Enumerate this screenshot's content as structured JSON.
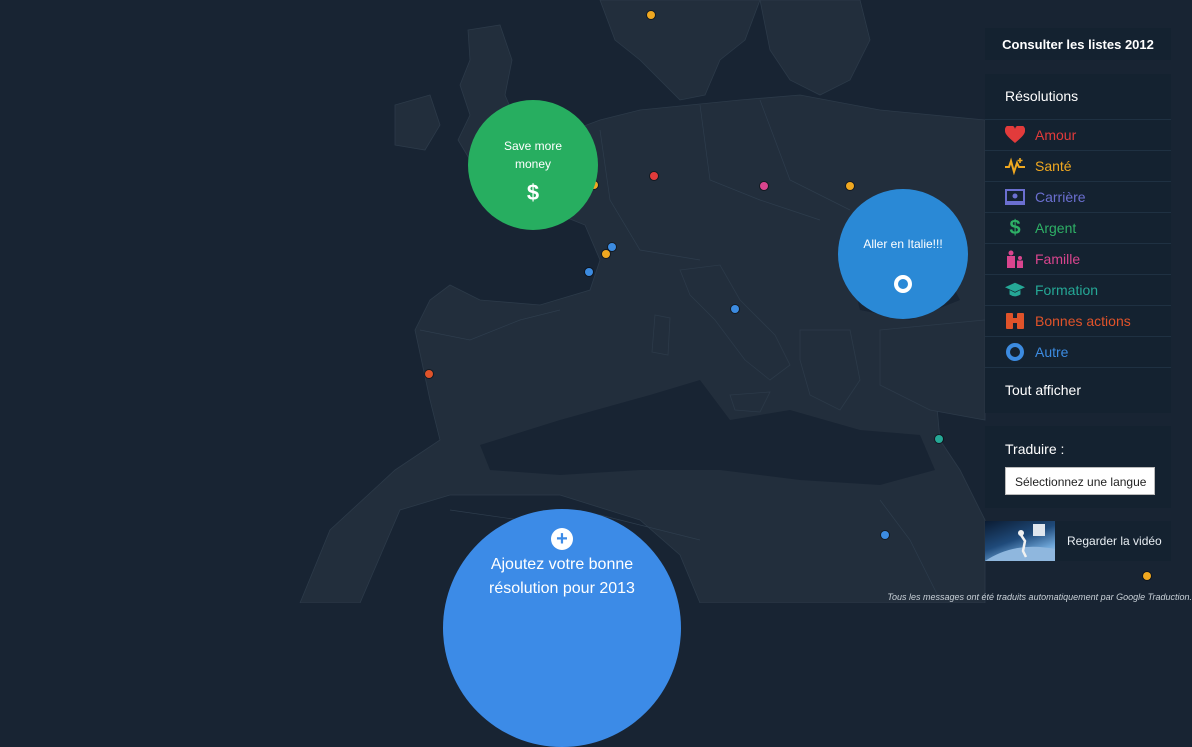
{
  "top_button": {
    "label": "Consulter les listes 2012"
  },
  "resolutions": {
    "title": "Résolutions",
    "items": [
      {
        "label": "Amour",
        "color": "#e23b3b",
        "icon": "heart-icon"
      },
      {
        "label": "Santé",
        "color": "#f0a820",
        "icon": "health-pulse-icon"
      },
      {
        "label": "Carrière",
        "color": "#6b6fd0",
        "icon": "career-board-icon"
      },
      {
        "label": "Argent",
        "color": "#2eb066",
        "icon": "dollar-icon"
      },
      {
        "label": "Famille",
        "color": "#d9458e",
        "icon": "family-icon"
      },
      {
        "label": "Formation",
        "color": "#25a896",
        "icon": "graduation-cap-icon"
      },
      {
        "label": "Bonnes actions",
        "color": "#e0532a",
        "icon": "binoculars-icon"
      },
      {
        "label": "Autre",
        "color": "#3c8be0",
        "icon": "ring-icon"
      }
    ],
    "show_all": "Tout afficher"
  },
  "translate": {
    "label": "Traduire :",
    "select_value": "Sélectionnez une langue"
  },
  "video": {
    "label": "Regarder la vidéo"
  },
  "bubbles": {
    "green": {
      "text_line1": "Save more",
      "text_line2": "money",
      "icon": "dollar-icon",
      "color": "#27ae60"
    },
    "blue": {
      "text": "Aller en Italie!!!",
      "icon": "ring-icon",
      "color": "#2a89d6"
    },
    "add": {
      "line1": "Ajoutez votre bonne",
      "line2": "résolution pour 2013",
      "icon": "plus-icon",
      "color": "#3c8be7"
    }
  },
  "footer_note": "Tous les messages ont été traduits automatiquement par Google Traduction.",
  "colors": {
    "background": "#182433",
    "land": "#222e3c",
    "panel": "#142230"
  }
}
